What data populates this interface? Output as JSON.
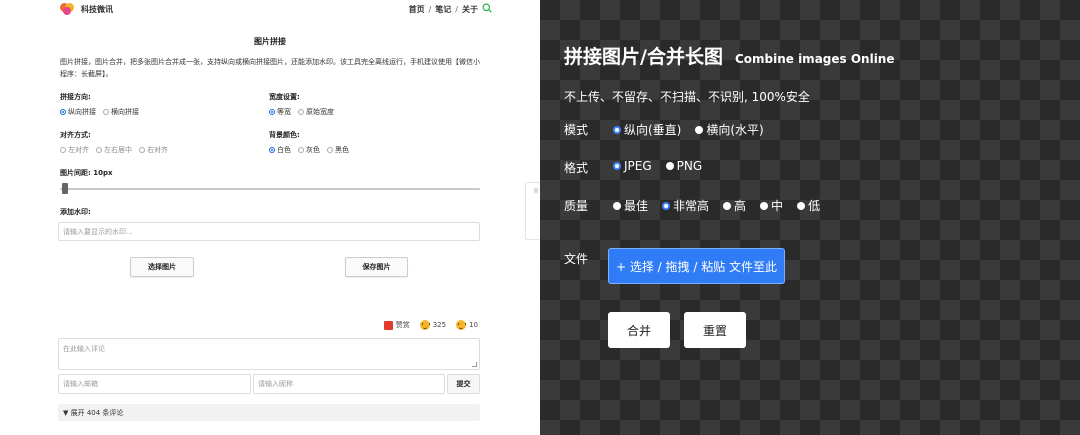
{
  "left": {
    "header": {
      "brand": "科技微讯",
      "nav": [
        "首页",
        "笔记",
        "关于"
      ],
      "nav_sep": "/"
    },
    "title": "图片拼接",
    "description": "图片拼接，图片合并，把多张图片合并成一张，支持纵向或横向拼接图片，还能添加水印。该工具完全离线运行，手机建议使用【微信小程序：长截屏】。",
    "direction": {
      "label": "拼接方向:",
      "options": [
        "纵向拼接",
        "横向拼接"
      ],
      "selected": "纵向拼接"
    },
    "width_setting": {
      "label": "宽度设置:",
      "options": [
        "等宽",
        "原始宽度"
      ],
      "selected": "等宽"
    },
    "align": {
      "label": "对齐方式:",
      "options": [
        "左对齐",
        "左右居中",
        "右对齐"
      ],
      "selected": "左右居中"
    },
    "bg_color": {
      "label": "背景颜色:",
      "options": [
        "白色",
        "灰色",
        "黑色"
      ],
      "selected": "白色"
    },
    "spacing": {
      "label": "图片间距: 10px",
      "value_fraction": 0.01
    },
    "watermark": {
      "label": "添加水印:",
      "placeholder": "请输入要显示的水印..."
    },
    "buttons": {
      "choose": "选择图片",
      "save": "保存图片"
    },
    "side_ghost": "首",
    "reactions": {
      "reward": "赞赏",
      "like_count": "325",
      "dislike_count": "10"
    },
    "comment": {
      "placeholder": "在此输入评论",
      "email_placeholder": "请输入邮箱",
      "nick_placeholder": "请输入昵称",
      "submit": "提交",
      "expand": "▼ 展开 404 条评论"
    }
  },
  "right": {
    "title_zh": "拼接图片/合并长图",
    "title_en": "Combine images Online",
    "subtitle": "不上传、不留存、不扫描、不识别, 100%安全",
    "mode": {
      "label": "模式",
      "options": [
        "纵向(垂直)",
        "横向(水平)"
      ],
      "selected": "纵向(垂直)"
    },
    "format": {
      "label": "格式",
      "options": [
        "JPEG",
        "PNG"
      ],
      "selected": "JPEG"
    },
    "quality": {
      "label": "质量",
      "options": [
        "最佳",
        "非常高",
        "高",
        "中",
        "低"
      ],
      "selected": "非常高"
    },
    "file": {
      "label": "文件",
      "upload": "+ 选择 / 拖拽 / 粘贴 文件至此"
    },
    "buttons": {
      "merge": "合并",
      "reset": "重置"
    }
  },
  "colors": {
    "accent_blue": "#2f7cf6",
    "radio_blue": "#1e6fe0",
    "dark_bg": "#2a2a2a",
    "reward_red": "#e23b2e"
  }
}
